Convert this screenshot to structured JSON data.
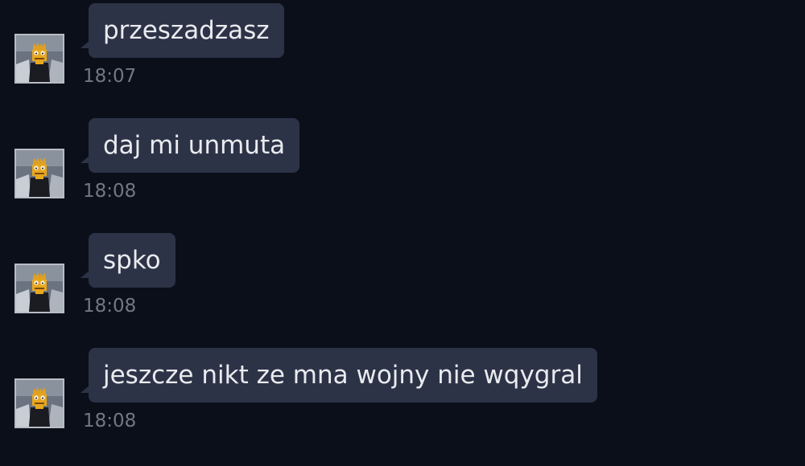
{
  "messages": [
    {
      "text": "przeszadzasz",
      "time": "18:07"
    },
    {
      "text": "daj mi unmuta",
      "time": "18:08"
    },
    {
      "text": "spko",
      "time": "18:08"
    },
    {
      "text": "jeszcze nikt ze mna wojny nie wqygral",
      "time": "18:08"
    }
  ],
  "avatar_icon": "bart-simpson-avatar-icon",
  "colors": {
    "background": "#0a0f19",
    "bubble": "#2d3347",
    "message_text": "#e9ebef",
    "timestamp": "#727783"
  }
}
